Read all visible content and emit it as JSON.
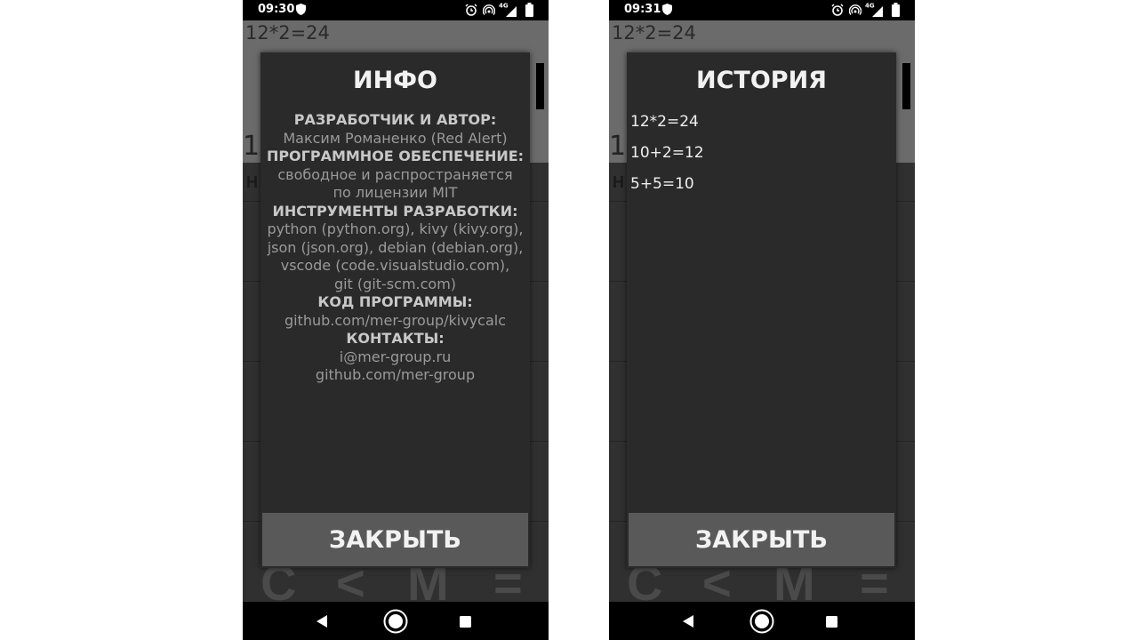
{
  "screens": [
    {
      "status_time": "09:30",
      "calc": {
        "expression": "12*2=24",
        "digit": "1",
        "mark": "H",
        "buttons": [
          "C",
          "<",
          "M",
          "="
        ]
      },
      "dialog": {
        "title": "ИНФО",
        "lines": [
          {
            "text": "РАЗРАБОТЧИК И АВТОР:",
            "kind": "head"
          },
          {
            "text": "Максим Романенко (Red Alert)",
            "kind": "val"
          },
          {
            "text": "ПРОГРАММНОЕ ОБЕСПЕЧЕНИЕ:",
            "kind": "head"
          },
          {
            "text": "свободное и распространяется",
            "kind": "val"
          },
          {
            "text": "по лицензии MIT",
            "kind": "val"
          },
          {
            "text": "ИНСТРУМЕНТЫ РАЗРАБОТКИ:",
            "kind": "head"
          },
          {
            "text": "python (python.org), kivy (kivy.org),",
            "kind": "val"
          },
          {
            "text": "json (json.org), debian (debian.org),",
            "kind": "val"
          },
          {
            "text": "vscode (code.visualstudio.com),",
            "kind": "val"
          },
          {
            "text": "git (git-scm.com)",
            "kind": "val"
          },
          {
            "text": "КОД ПРОГРАММЫ:",
            "kind": "head"
          },
          {
            "text": "github.com/mer-group/kivycalc",
            "kind": "val"
          },
          {
            "text": "КОНТАКТЫ:",
            "kind": "head"
          },
          {
            "text": "i@mer-group.ru",
            "kind": "val"
          },
          {
            "text": "github.com/mer-group",
            "kind": "val"
          }
        ],
        "close_label": "ЗАКРЫТЬ"
      }
    },
    {
      "status_time": "09:31",
      "calc": {
        "expression": "12*2=24",
        "digit": "1",
        "mark": "H",
        "buttons": [
          "C",
          "<",
          "M",
          "="
        ]
      },
      "dialog": {
        "title": "ИСТОРИЯ",
        "history": [
          "12*2=24",
          "10+2=12",
          "5+5=10"
        ],
        "close_label": "ЗАКРЫТЬ"
      }
    }
  ],
  "status_icons": [
    "shield-icon",
    "alarm-icon",
    "hotspot-icon",
    "signal-4g-icon",
    "battery-icon"
  ],
  "status_network": "4G",
  "nav_icons": [
    "back-icon",
    "home-icon",
    "recent-apps-icon"
  ],
  "colors": {
    "dialog_bg": "#2a2a2a",
    "close_button": "#595959",
    "text_light": "#f2f2f2",
    "info_value": "#9a9a9a"
  }
}
